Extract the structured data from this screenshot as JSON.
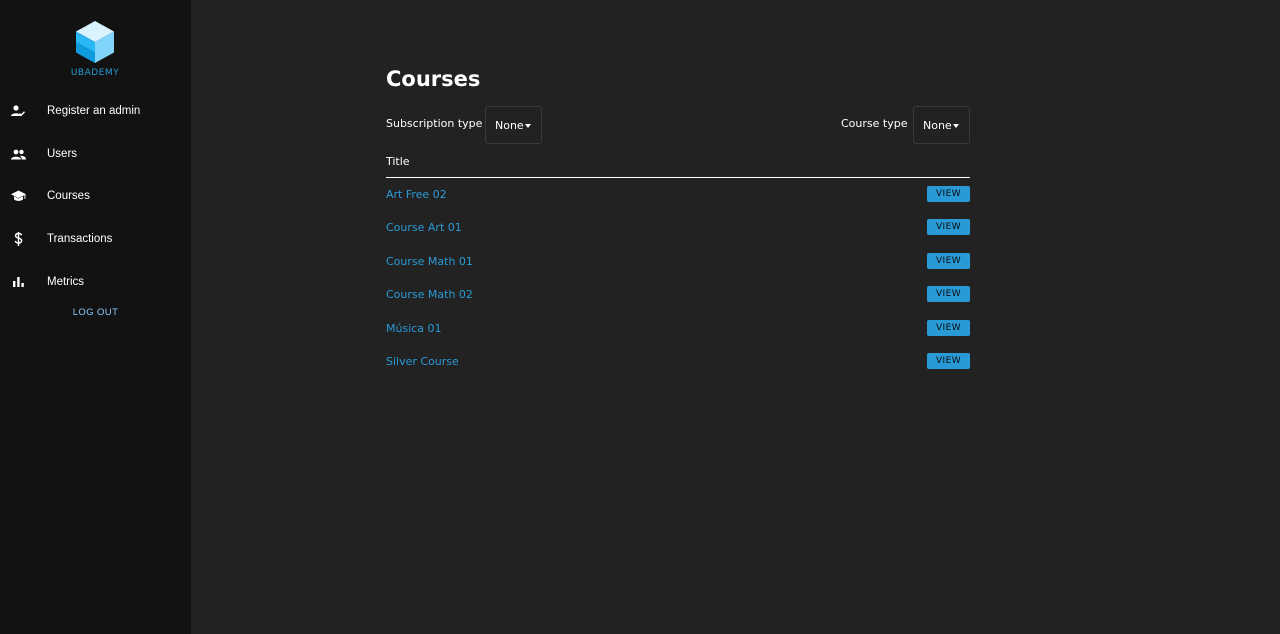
{
  "brand": {
    "name": "UBADEMY",
    "color": "#2a9ad6"
  },
  "sidebar": {
    "items": [
      {
        "label": "Register an admin",
        "icon": "person-check-icon"
      },
      {
        "label": "Users",
        "icon": "people-icon"
      },
      {
        "label": "Courses",
        "icon": "school-icon"
      },
      {
        "label": "Transactions",
        "icon": "dollar-icon"
      },
      {
        "label": "Metrics",
        "icon": "bar-chart-icon"
      }
    ],
    "logout_label": "LOG OUT"
  },
  "main": {
    "title": "Courses",
    "filters": {
      "subscription": {
        "label": "Subscription type",
        "value": "None"
      },
      "course_type": {
        "label": "Course type",
        "value": "None"
      }
    },
    "table": {
      "header": "Title",
      "action_label": "VIEW",
      "rows": [
        {
          "title": "Art Free 02"
        },
        {
          "title": "Course Art 01"
        },
        {
          "title": "Course Math 01"
        },
        {
          "title": "Course Math 02"
        },
        {
          "title": "Música 01"
        },
        {
          "title": "Silver Course"
        }
      ]
    }
  },
  "colors": {
    "background": "#222222",
    "sidebar": "#121212",
    "accent": "#2a9ad6",
    "logout": "#90caf9"
  }
}
